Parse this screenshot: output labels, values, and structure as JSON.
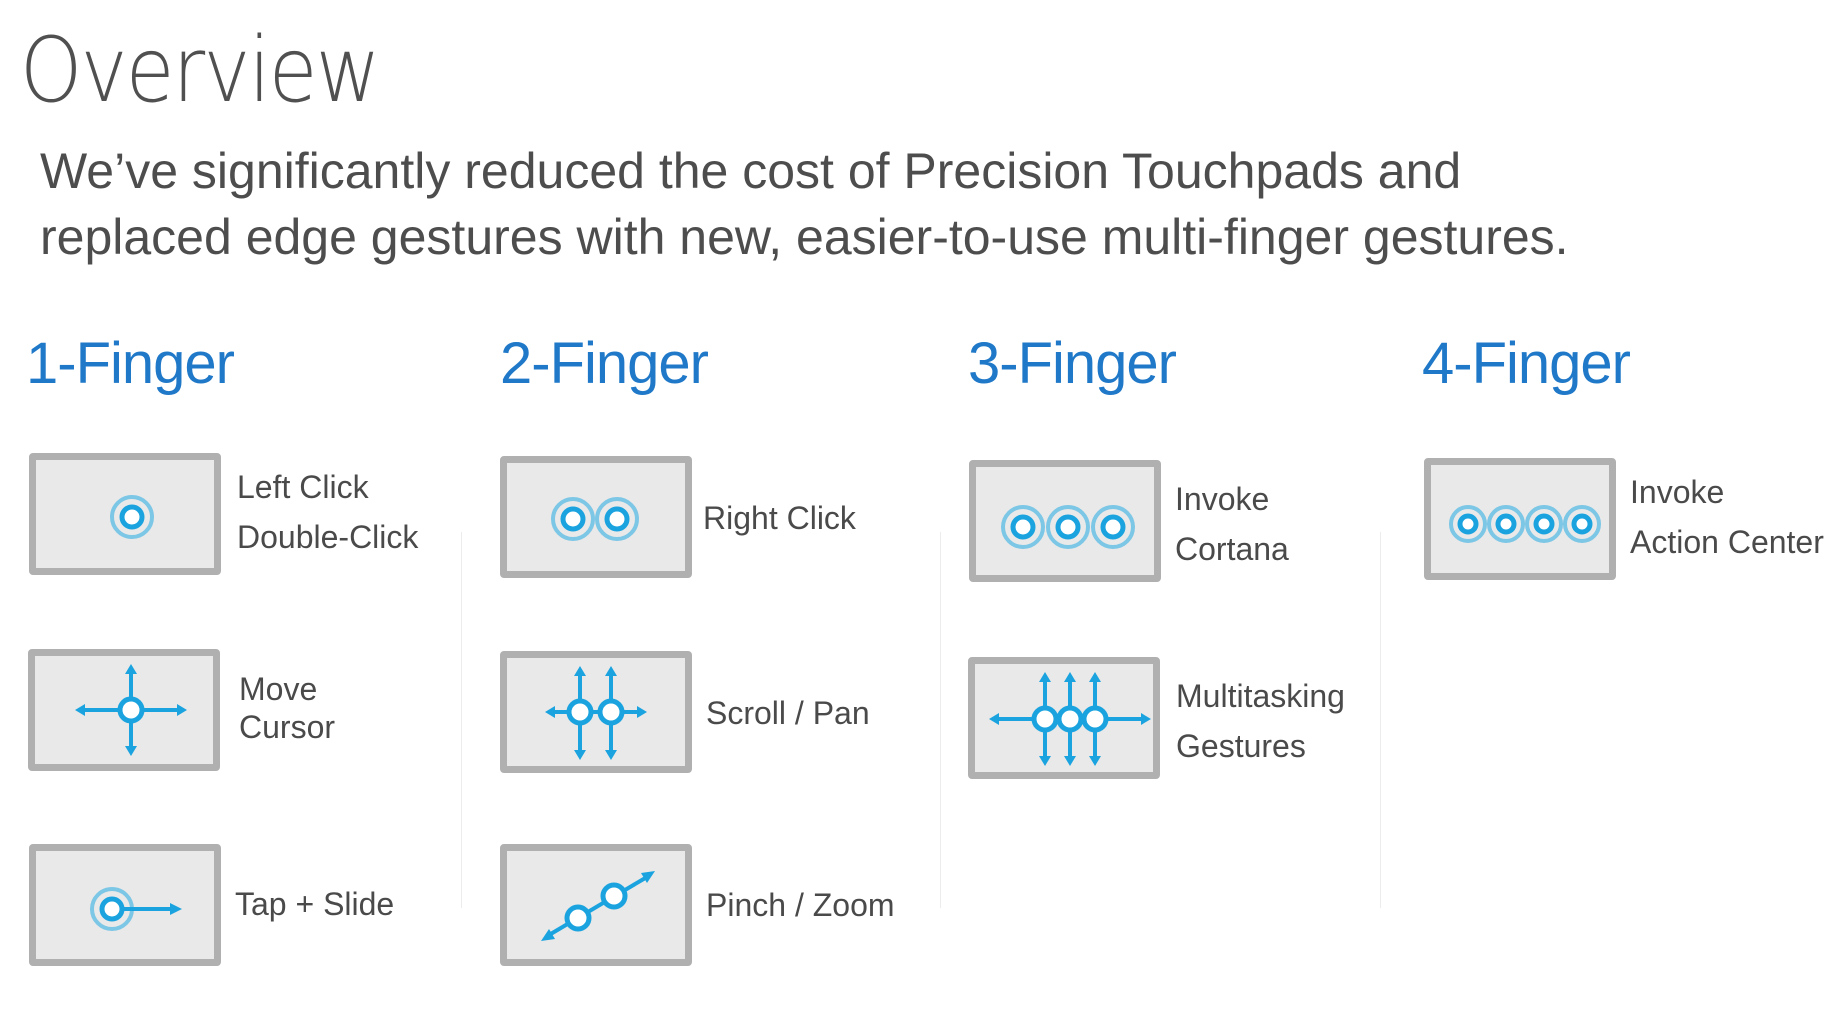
{
  "slide": {
    "title": "Overview",
    "subtitle_lines": [
      "We’ve significantly reduced the cost of Precision Touchpads and",
      "replaced edge gestures with new, easier-to-use multi-finger gestures."
    ],
    "accent_color": "#1f78c8",
    "icon_color": "#1aa3df",
    "columns": [
      {
        "heading": "1-Finger",
        "gestures": [
          {
            "icon": "single-tap-icon",
            "label_lines": [
              "Left Click",
              "Double-Click"
            ]
          },
          {
            "icon": "move-cursor-icon",
            "label_lines": [
              "Move",
              "Cursor"
            ]
          },
          {
            "icon": "tap-slide-icon",
            "label_lines": [
              "Tap + Slide"
            ]
          }
        ]
      },
      {
        "heading": "2-Finger",
        "gestures": [
          {
            "icon": "two-finger-tap-icon",
            "label_lines": [
              "Right Click"
            ]
          },
          {
            "icon": "scroll-pan-icon",
            "label_lines": [
              "Scroll / Pan"
            ]
          },
          {
            "icon": "pinch-zoom-icon",
            "label_lines": [
              "Pinch / Zoom"
            ]
          }
        ]
      },
      {
        "heading": "3-Finger",
        "gestures": [
          {
            "icon": "three-finger-tap-icon",
            "label_lines": [
              "Invoke",
              "Cortana"
            ]
          },
          {
            "icon": "multitasking-gestures-icon",
            "label_lines": [
              "Multitasking",
              "Gestures"
            ]
          }
        ]
      },
      {
        "heading": "4-Finger",
        "gestures": [
          {
            "icon": "four-finger-tap-icon",
            "label_lines": [
              "Invoke",
              "Action Center"
            ]
          }
        ]
      }
    ]
  }
}
